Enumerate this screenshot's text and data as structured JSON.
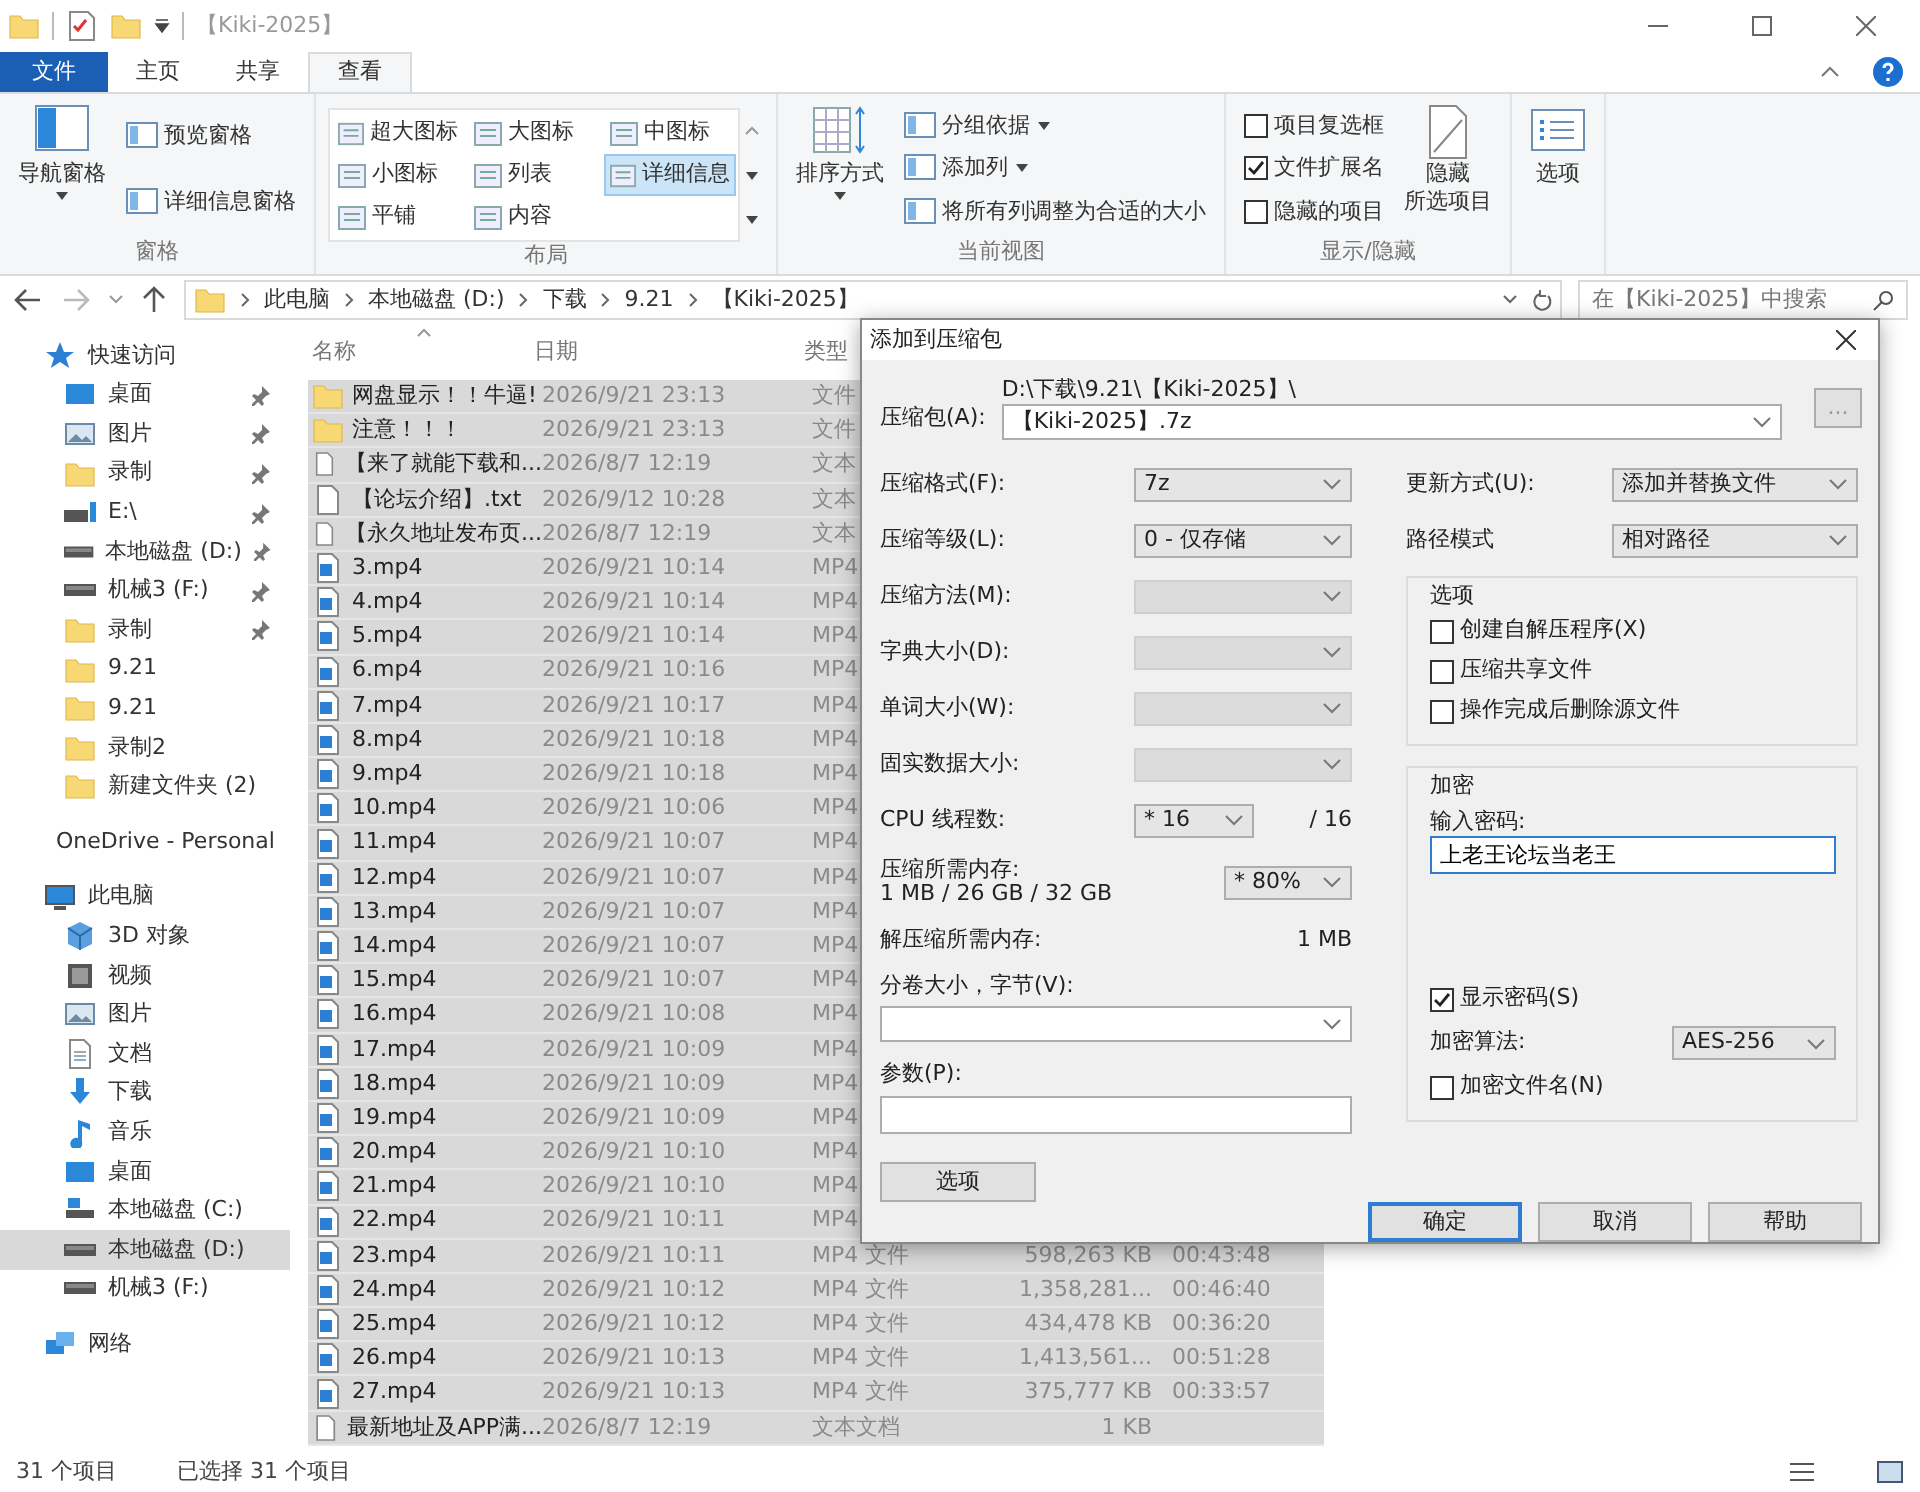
{
  "window": {
    "title": "【Kiki-2025】"
  },
  "ribbon_tabs": [
    {
      "label": "文件",
      "kind": "file",
      "selected": false
    },
    {
      "label": "主页",
      "kind": "tab",
      "selected": false
    },
    {
      "label": "共享",
      "kind": "tab",
      "selected": false
    },
    {
      "label": "查看",
      "kind": "tab",
      "selected": true
    }
  ],
  "ribbon_groups": [
    {
      "label": "窗格",
      "items": [
        {
          "kind": "large",
          "lines": [
            "导航窗格"
          ],
          "dropdown": true
        },
        {
          "kind": "small",
          "label": "预览窗格",
          "dropdown": false
        },
        {
          "kind": "small",
          "label": "详细信息窗格",
          "dropdown": false
        }
      ]
    },
    {
      "label": "布局",
      "items": [
        {
          "kind": "gallery",
          "options": [
            {
              "label": "超大图标",
              "selected": false
            },
            {
              "label": "大图标",
              "selected": false
            },
            {
              "label": "中图标",
              "selected": false
            },
            {
              "label": "小图标",
              "selected": false
            },
            {
              "label": "列表",
              "selected": false
            },
            {
              "label": "详细信息",
              "selected": true
            },
            {
              "label": "平铺",
              "selected": false
            },
            {
              "label": "内容",
              "selected": false
            }
          ]
        }
      ]
    },
    {
      "label": "当前视图",
      "items": [
        {
          "kind": "large",
          "lines": [
            "排序方式"
          ],
          "dropdown": true
        },
        {
          "kind": "small",
          "label": "分组依据",
          "dropdown": true
        },
        {
          "kind": "small",
          "label": "添加列",
          "dropdown": true
        },
        {
          "kind": "small",
          "label": "将所有列调整为合适的大小",
          "dropdown": false
        }
      ]
    },
    {
      "label": "显示/隐藏",
      "items": [
        {
          "kind": "checkbox",
          "label": "项目复选框",
          "checked": false
        },
        {
          "kind": "checkbox",
          "label": "文件扩展名",
          "checked": true
        },
        {
          "kind": "checkbox",
          "label": "隐藏的项目",
          "checked": false
        },
        {
          "kind": "large",
          "lines": [
            "隐藏",
            "所选项目"
          ],
          "dropdown": false
        }
      ]
    },
    {
      "items": [
        {
          "kind": "large",
          "lines": [
            "选项"
          ],
          "dropdown": false
        }
      ]
    }
  ],
  "address_bar": {
    "path": [
      "此电脑",
      "本地磁盘 (D:)",
      "下载",
      "9.21",
      "【Kiki-2025】"
    ],
    "search_placeholder": "在【Kiki-2025】中搜索"
  },
  "navigation": [
    {
      "label": "快速访问",
      "kind": "star",
      "selected": false,
      "children": [
        {
          "label": "桌面",
          "kind": "desktop",
          "pinned": true,
          "selected": false
        },
        {
          "label": "图片",
          "kind": "pictures",
          "pinned": true,
          "selected": false
        },
        {
          "label": "录制",
          "kind": "folder",
          "pinned": true,
          "selected": false
        },
        {
          "label": "E:\\",
          "kind": "netdrive",
          "pinned": true,
          "selected": false
        },
        {
          "label": "本地磁盘 (D:)",
          "kind": "drive",
          "pinned": true,
          "selected": false
        },
        {
          "label": "机械3 (F:)",
          "kind": "drive",
          "pinned": true,
          "selected": false
        },
        {
          "label": "录制",
          "kind": "folder",
          "pinned": true,
          "selected": false
        },
        {
          "label": "9.21",
          "kind": "folder",
          "pinned": false,
          "selected": false
        },
        {
          "label": "9.21",
          "kind": "folder",
          "pinned": false,
          "selected": false
        },
        {
          "label": "录制2",
          "kind": "folder",
          "pinned": false,
          "selected": false
        },
        {
          "label": "新建文件夹 (2)",
          "kind": "folder",
          "pinned": false,
          "selected": false
        }
      ]
    },
    {
      "label": "OneDrive - Personal",
      "kind": "cloud",
      "selected": false
    },
    {
      "label": "此电脑",
      "kind": "computer",
      "selected": false,
      "children": [
        {
          "label": "3D 对象",
          "kind": "cube",
          "pinned": false,
          "selected": false
        },
        {
          "label": "视频",
          "kind": "film",
          "pinned": false,
          "selected": false
        },
        {
          "label": "图片",
          "kind": "pictures",
          "pinned": false,
          "selected": false
        },
        {
          "label": "文档",
          "kind": "textfile",
          "pinned": false,
          "selected": false
        },
        {
          "label": "下载",
          "kind": "download",
          "pinned": false,
          "selected": false
        },
        {
          "label": "音乐",
          "kind": "music",
          "pinned": false,
          "selected": false
        },
        {
          "label": "桌面",
          "kind": "desktop",
          "pinned": false,
          "selected": false
        },
        {
          "label": "本地磁盘 (C:)",
          "kind": "sysdrive",
          "pinned": false,
          "selected": false
        },
        {
          "label": "本地磁盘 (D:)",
          "kind": "drive",
          "pinned": false,
          "selected": true
        },
        {
          "label": "机械3 (F:)",
          "kind": "drive",
          "pinned": false,
          "selected": false
        }
      ]
    },
    {
      "label": "网络",
      "kind": "network",
      "selected": false
    }
  ],
  "file_list": {
    "columns": [
      "名称",
      "日期",
      "类型"
    ],
    "rows": [
      {
        "kind": "folder",
        "name": "网盘显示！！牛逼!",
        "date": "2026/9/21 23:13",
        "type": "文件",
        "selected": true
      },
      {
        "kind": "folder",
        "name": "注意！！！",
        "date": "2026/9/21 23:13",
        "type": "文件",
        "selected": true
      },
      {
        "kind": "text",
        "name": "【来了就能下载和...",
        "date": "2026/8/7 12:19",
        "type": "文本",
        "selected": true
      },
      {
        "kind": "text",
        "name": "【论坛介绍】.txt",
        "date": "2026/9/12 10:28",
        "type": "文本",
        "selected": true
      },
      {
        "kind": "text",
        "name": "【永久地址发布页...",
        "date": "2026/8/7 12:19",
        "type": "文本",
        "selected": true
      },
      {
        "kind": "video",
        "name": "3.mp4",
        "date": "2026/9/21 10:14",
        "type": "MP4",
        "selected": true
      },
      {
        "kind": "video",
        "name": "4.mp4",
        "date": "2026/9/21 10:14",
        "type": "MP4",
        "selected": true
      },
      {
        "kind": "video",
        "name": "5.mp4",
        "date": "2026/9/21 10:14",
        "type": "MP4",
        "selected": true
      },
      {
        "kind": "video",
        "name": "6.mp4",
        "date": "2026/9/21 10:16",
        "type": "MP4",
        "selected": true
      },
      {
        "kind": "video",
        "name": "7.mp4",
        "date": "2026/9/21 10:17",
        "type": "MP4",
        "selected": true
      },
      {
        "kind": "video",
        "name": "8.mp4",
        "date": "2026/9/21 10:18",
        "type": "MP4",
        "selected": true
      },
      {
        "kind": "video",
        "name": "9.mp4",
        "date": "2026/9/21 10:18",
        "type": "MP4",
        "selected": true
      },
      {
        "kind": "video",
        "name": "10.mp4",
        "date": "2026/9/21 10:06",
        "type": "MP4",
        "selected": true
      },
      {
        "kind": "video",
        "name": "11.mp4",
        "date": "2026/9/21 10:07",
        "type": "MP4",
        "selected": true
      },
      {
        "kind": "video",
        "name": "12.mp4",
        "date": "2026/9/21 10:07",
        "type": "MP4",
        "selected": true
      },
      {
        "kind": "video",
        "name": "13.mp4",
        "date": "2026/9/21 10:07",
        "type": "MP4",
        "selected": true
      },
      {
        "kind": "video",
        "name": "14.mp4",
        "date": "2026/9/21 10:07",
        "type": "MP4",
        "selected": true
      },
      {
        "kind": "video",
        "name": "15.mp4",
        "date": "2026/9/21 10:07",
        "type": "MP4",
        "selected": true
      },
      {
        "kind": "video",
        "name": "16.mp4",
        "date": "2026/9/21 10:08",
        "type": "MP4",
        "selected": true
      },
      {
        "kind": "video",
        "name": "17.mp4",
        "date": "2026/9/21 10:09",
        "type": "MP4",
        "selected": true
      },
      {
        "kind": "video",
        "name": "18.mp4",
        "date": "2026/9/21 10:09",
        "type": "MP4",
        "selected": true
      },
      {
        "kind": "video",
        "name": "19.mp4",
        "date": "2026/9/21 10:09",
        "type": "MP4",
        "selected": true
      },
      {
        "kind": "video",
        "name": "20.mp4",
        "date": "2026/9/21 10:10",
        "type": "MP4",
        "selected": true
      },
      {
        "kind": "video",
        "name": "21.mp4",
        "date": "2026/9/21 10:10",
        "type": "MP4",
        "selected": true
      },
      {
        "kind": "video",
        "name": "22.mp4",
        "date": "2026/9/21 10:11",
        "type": "MP4",
        "selected": true
      },
      {
        "kind": "video",
        "name": "23.mp4",
        "date": "2026/9/21 10:11",
        "type": "MP4 文件",
        "column_4": "598,263 KB",
        "column_5": "00:43:48",
        "selected": true
      },
      {
        "kind": "video",
        "name": "24.mp4",
        "date": "2026/9/21 10:12",
        "type": "MP4 文件",
        "column_4": "1,358,281...",
        "column_5": "00:46:40",
        "selected": true
      },
      {
        "kind": "video",
        "name": "25.mp4",
        "date": "2026/9/21 10:12",
        "type": "MP4 文件",
        "column_4": "434,478 KB",
        "column_5": "00:36:20",
        "selected": true
      },
      {
        "kind": "video",
        "name": "26.mp4",
        "date": "2026/9/21 10:13",
        "type": "MP4 文件",
        "column_4": "1,413,561...",
        "column_5": "00:51:28",
        "selected": true
      },
      {
        "kind": "video",
        "name": "27.mp4",
        "date": "2026/9/21 10:13",
        "type": "MP4 文件",
        "column_4": "375,777 KB",
        "column_5": "00:33:57",
        "selected": true
      },
      {
        "kind": "text",
        "name": "最新地址及APP满...",
        "date": "2026/8/7 12:19",
        "type": "文本文档",
        "column_4": "1 KB",
        "selected": true
      }
    ]
  },
  "status_bar": {
    "items": "31 个项目",
    "selection": "已选择 31 个项目"
  },
  "dialog": {
    "title": "添加到压缩包",
    "archive": {
      "label": "压缩包(A):",
      "path": "D:\\下载\\9.21\\【Kiki-2025】\\",
      "value": "【Kiki-2025】.7z",
      "browse": "..."
    },
    "left_fields": [
      {
        "kind": "select",
        "label": "压缩格式(F):",
        "value": "7z",
        "disabled": false
      },
      {
        "kind": "select",
        "label": "压缩等级(L):",
        "value": "0 - 仅存储",
        "disabled": false
      },
      {
        "kind": "select",
        "label": "压缩方法(M):",
        "disabled": true
      },
      {
        "kind": "select",
        "label": "字典大小(D):",
        "disabled": true
      },
      {
        "kind": "select",
        "label": "单词大小(W):",
        "disabled": true
      },
      {
        "kind": "select",
        "label": "固实数据大小:",
        "disabled": true
      },
      {
        "kind": "short-select",
        "label": "CPU 线程数:",
        "value": "* 16",
        "note": "/ 16",
        "disabled": false
      },
      {
        "kind": "memory",
        "label": "压缩所需内存:",
        "detail": "1 MB / 26 GB / 32 GB",
        "value": "* 80%",
        "disabled": false
      },
      {
        "kind": "info",
        "label": "解压缩所需内存:",
        "value": "1 MB",
        "disabled": false
      },
      {
        "kind": "wide-select",
        "label": "分卷大小，字节(V):",
        "disabled": false
      },
      {
        "kind": "wide-input",
        "label": "参数(P):",
        "disabled": false
      }
    ],
    "options_button": "选项",
    "right_fields": [
      {
        "label": "更新方式(U):",
        "value": "添加并替换文件"
      },
      {
        "label": "路径模式",
        "value": "相对路径"
      }
    ],
    "options_group": {
      "title": "选项",
      "checkboxes": [
        {
          "label": "创建自解压程序(X)",
          "checked": false
        },
        {
          "label": "压缩共享文件",
          "checked": false
        },
        {
          "label": "操作完成后删除源文件",
          "checked": false
        }
      ]
    },
    "encryption": {
      "title": "加密",
      "password_label": "输入密码:",
      "password": "上老王论坛当老王",
      "show_password": {
        "label": "显示密码(S)",
        "checked": true
      },
      "method_label": "加密算法:",
      "method": "AES-256",
      "encrypt_names": {
        "label": "加密文件名(N)",
        "checked": false
      }
    },
    "buttons": [
      {
        "label": "确定",
        "default": true
      },
      {
        "label": "取消",
        "default": false
      },
      {
        "label": "帮助",
        "default": false
      }
    ]
  }
}
